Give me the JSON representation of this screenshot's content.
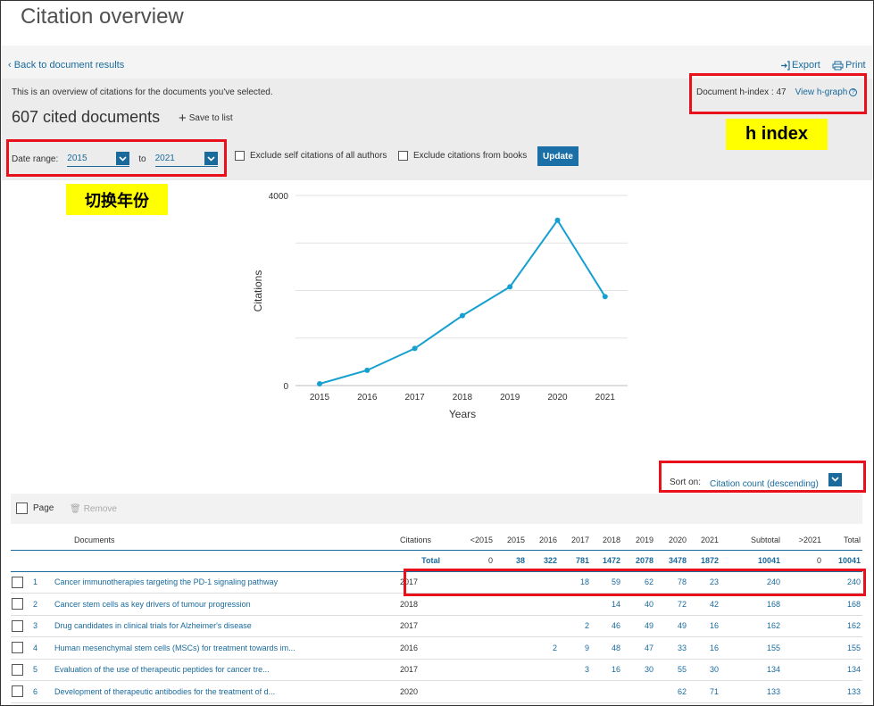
{
  "page": {
    "title": "Citation overview"
  },
  "nav": {
    "back_label": "Back to document results",
    "export_label": "Export",
    "print_label": "Print"
  },
  "summary": {
    "note": "This is an overview of citations for the documents you've selected.",
    "doc_count": "607 cited documents",
    "save_label": "Save to list",
    "hindex_label": "Document h-index : 47",
    "hgraph_label": "View h-graph"
  },
  "annotations": {
    "hindex_tag": "h index",
    "year_tag": "切换年份"
  },
  "filters": {
    "date_range_label": "Date range:",
    "from_year": "2015",
    "to_label": "to",
    "to_year": "2021",
    "exclude_self_label": "Exclude self citations of all authors",
    "exclude_books_label": "Exclude citations from books",
    "update_label": "Update"
  },
  "chart_data": {
    "type": "line",
    "x": [
      "2015",
      "2016",
      "2017",
      "2018",
      "2019",
      "2020",
      "2021"
    ],
    "series": [
      {
        "values": [
          38,
          322,
          781,
          1472,
          2078,
          3478,
          1872
        ]
      }
    ],
    "ylabel": "Citations",
    "xlabel": "Years",
    "ylim": [
      0,
      4000
    ],
    "yticks": [
      "0",
      "4000"
    ],
    "grid": true,
    "color": "#16a0d0"
  },
  "sort": {
    "label": "Sort on:",
    "value": "Citation count (descending)"
  },
  "toolbar": {
    "page_label": "Page",
    "remove_label": "Remove"
  },
  "table": {
    "headers": [
      "Documents",
      "Citations",
      "<2015",
      "2015",
      "2016",
      "2017",
      "2018",
      "2019",
      "2020",
      "2021",
      "Subtotal",
      ">2021",
      "Total"
    ],
    "totals": {
      "label": "Total",
      "values": [
        "0",
        "38",
        "322",
        "781",
        "1472",
        "2078",
        "3478",
        "1872",
        "10041",
        "0",
        "10041"
      ]
    },
    "rows": [
      {
        "index": "1",
        "title": "Cancer immunotherapies targeting the PD-1 signaling pathway",
        "year": "2017",
        "values": [
          "",
          "",
          "",
          "18",
          "59",
          "62",
          "78",
          "23",
          "240",
          "",
          "240"
        ]
      },
      {
        "index": "2",
        "title": "Cancer stem cells as key drivers of tumour progression",
        "year": "2018",
        "values": [
          "",
          "",
          "",
          "",
          "14",
          "40",
          "72",
          "42",
          "168",
          "",
          "168"
        ]
      },
      {
        "index": "3",
        "title": "Drug candidates in clinical trials for Alzheimer's disease",
        "year": "2017",
        "values": [
          "",
          "",
          "",
          "2",
          "46",
          "49",
          "49",
          "16",
          "162",
          "",
          "162"
        ]
      },
      {
        "index": "4",
        "title": "Human mesenchymal stem cells (MSCs) for treatment towards im...",
        "year": "2016",
        "values": [
          "",
          "",
          "2",
          "9",
          "48",
          "47",
          "33",
          "16",
          "155",
          "",
          "155"
        ]
      },
      {
        "index": "5",
        "title": "Evaluation of the use of therapeutic peptides for cancer tre...",
        "year": "2017",
        "values": [
          "",
          "",
          "",
          "3",
          "16",
          "30",
          "55",
          "30",
          "134",
          "",
          "134"
        ]
      },
      {
        "index": "6",
        "title": "Development of therapeutic antibodies for the treatment of d...",
        "year": "2020",
        "values": [
          "",
          "",
          "",
          "",
          "",
          "",
          "62",
          "71",
          "133",
          "",
          "133"
        ]
      }
    ]
  }
}
